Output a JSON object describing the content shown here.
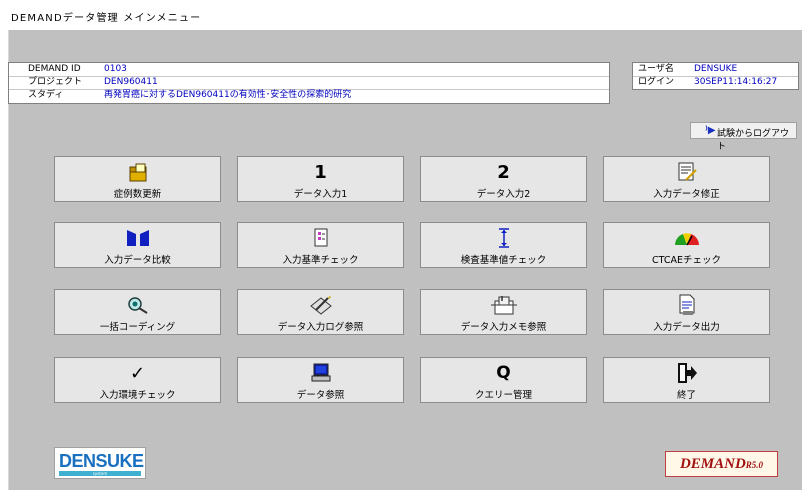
{
  "window": {
    "title": "DEMANDデータ管理 メインメニュー"
  },
  "info": {
    "demand_id_label": "DEMAND ID",
    "demand_id": "0103",
    "project_label": "プロジェクト",
    "project": "DEN960411",
    "study_label": "スタディ",
    "study": "再発胃癌に対するDEN960411の有効性･安全性の探索的研究"
  },
  "user": {
    "name_label": "ユーザ名",
    "name": "DENSUKE",
    "login_label": "ログイン",
    "login": "30SEP11:14:16:27"
  },
  "logout_button": {
    "icon": "logout-icon",
    "label": "試験からログアウト"
  },
  "menu": [
    {
      "number": "",
      "label": "症例数更新"
    },
    {
      "number": "1",
      "label": "データ入力1"
    },
    {
      "number": "2",
      "label": "データ入力2"
    },
    {
      "number": "",
      "label": "入力データ修正"
    },
    {
      "number": "",
      "label": "入力データ比較"
    },
    {
      "number": "",
      "label": "入力基準チェック"
    },
    {
      "number": "",
      "label": "検査基準値チェック"
    },
    {
      "number": "",
      "label": "CTCAEチェック"
    },
    {
      "number": "",
      "label": "一括コーディング"
    },
    {
      "number": "",
      "label": "データ入力ログ参照"
    },
    {
      "number": "",
      "label": "データ入力メモ参照"
    },
    {
      "number": "",
      "label": "入力データ出力"
    },
    {
      "number": "✓",
      "label": "入力環境チェック"
    },
    {
      "number": "",
      "label": "データ参照"
    },
    {
      "number": "Q",
      "label": "クエリー管理"
    },
    {
      "number": "",
      "label": "終了"
    }
  ],
  "logos": {
    "left": "DENSUKE",
    "left_sub": "system",
    "right": "DEMAND",
    "right_version": "R5.0"
  },
  "colors": {
    "background": "#c0c0c0",
    "value_text": "#0000c0",
    "button_face": "#e6e6e6"
  }
}
